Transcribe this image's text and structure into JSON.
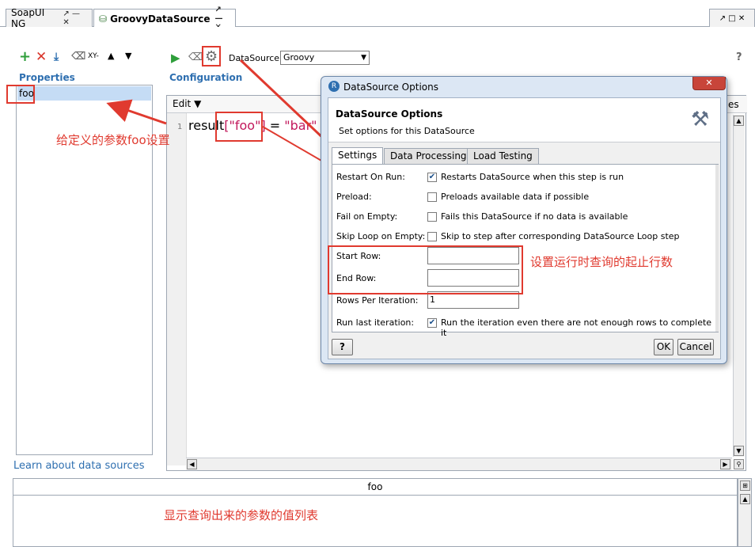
{
  "tabs": [
    {
      "label": "SoapUI NG",
      "controls": "↗ — ✕"
    },
    {
      "label": "GroovyDataSource",
      "controls": "↗ — ✕"
    }
  ],
  "window_controls": "↗ □ ✕",
  "left_panel": {
    "section_label": "Properties",
    "toolbar_extra": "XY-",
    "properties": [
      "foo"
    ],
    "learn_link": "Learn about data sources"
  },
  "config": {
    "section_label": "Configuration",
    "datasource_label": "DataSource:",
    "datasource_value": "Groovy",
    "help": "?",
    "edit_menu": "Edit",
    "line_number": "1",
    "code": {
      "p1": "result",
      "p2": "[\"foo\"]",
      "p3": " = ",
      "p4": "\"bar\""
    }
  },
  "bottom_table": {
    "header": "foo"
  },
  "dialog": {
    "window_title": "DataSource Options",
    "heading": "DataSource Options",
    "subheading": "Set options for this DataSource",
    "tabs": [
      "Settings",
      "Data Processing",
      "Load Testing"
    ],
    "rows": [
      {
        "label": "Restart On Run:",
        "checked": true,
        "text": "Restarts DataSource when this step is run"
      },
      {
        "label": "Preload:",
        "checked": false,
        "text": "Preloads available data if possible"
      },
      {
        "label": "Fail on Empty:",
        "checked": false,
        "text": "Fails this DataSource if no data is available"
      },
      {
        "label": "Skip Loop on Empty:",
        "checked": false,
        "text": "Skip to step after corresponding DataSource Loop step"
      }
    ],
    "start_row_label": "Start Row:",
    "start_row_value": "",
    "end_row_label": "End Row:",
    "end_row_value": "",
    "rows_per_iter_label": "Rows Per Iteration:",
    "rows_per_iter_value": "1",
    "run_last_label": "Run last iteration:",
    "run_last_checked": true,
    "run_last_text": "Run the iteration even there are not enough rows to complete it",
    "help_btn": "?",
    "ok": "OK",
    "cancel": "Cancel",
    "partial_right": "es"
  },
  "annotations": {
    "param_note": "给定义的参数foo设置",
    "rows_note": "设置运行时查询的起止行数",
    "list_note": "显示查询出来的参数的值列表",
    "color": "#e03a2f"
  }
}
